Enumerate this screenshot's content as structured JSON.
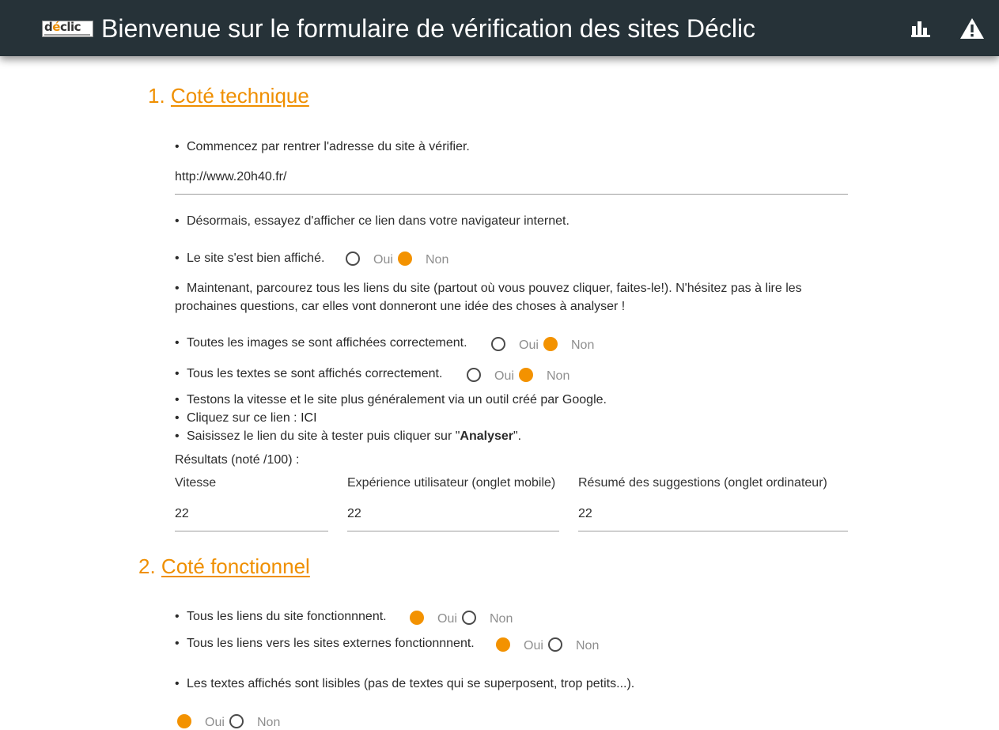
{
  "header": {
    "title": "Bienvenue sur le formulaire de vérification des sites Déclic",
    "logo_text_main": "d",
    "logo_text_accent": "é",
    "logo_text_rest": "clic",
    "icons": [
      "bar-chart-icon",
      "warning-icon"
    ]
  },
  "section1": {
    "number": "1.",
    "title": "Coté technique",
    "q_address": "Commencez par rentrer l'adresse du site à vérifier.",
    "address_value": "http://www.20h40.fr/",
    "q_display_link": "Désormais, essayez d'afficher ce lien dans votre navigateur internet.",
    "q_site_displayed": "Le site s'est bien affiché.",
    "q_browse": "Maintenant, parcourez tous les liens du site (partout où vous pouvez cliquer, faites-le!). N'hésitez pas à lire les prochaines questions, car elles vont donneront une idée des choses à analyser !",
    "q_images": "Toutes les images se sont affichées correctement.",
    "q_texts": "Tous les textes se sont affichés correctement.",
    "q_speed": "Testons la vitesse et le site plus généralement via un outil créé par Google.",
    "q_click_prefix": "Cliquez sur ce lien : ",
    "q_click_link": "ICI",
    "q_enter_prefix": "Saisissez le lien du site à tester puis cliquer sur \"",
    "q_enter_bold": "Analyser",
    "q_enter_suffix": "\".",
    "results_label": "Résultats (noté /100) :",
    "results": [
      {
        "label": "Vitesse",
        "value": "22"
      },
      {
        "label": "Expérience utilisateur (onglet mobile)",
        "value": "22"
      },
      {
        "label": "Résumé des suggestions (onglet ordinateur)",
        "value": "22"
      }
    ]
  },
  "section2": {
    "number": "2.",
    "title": "Coté fonctionnel",
    "q_links": "Tous les liens du site fonctionnnent.",
    "q_external": "Tous les liens vers les sites externes fonctionnnent.",
    "q_readable": "Les textes affichés sont lisibles (pas de textes qui se superposent, trop petits...)."
  },
  "options": {
    "yes": "Oui",
    "no": "Non"
  },
  "answers": {
    "site_displayed": "Non",
    "images": "Non",
    "texts": "Non",
    "links": "Oui",
    "external": "Oui",
    "readable": "Oui"
  },
  "colors": {
    "header_bg": "#263238",
    "accent": "#f39200"
  }
}
